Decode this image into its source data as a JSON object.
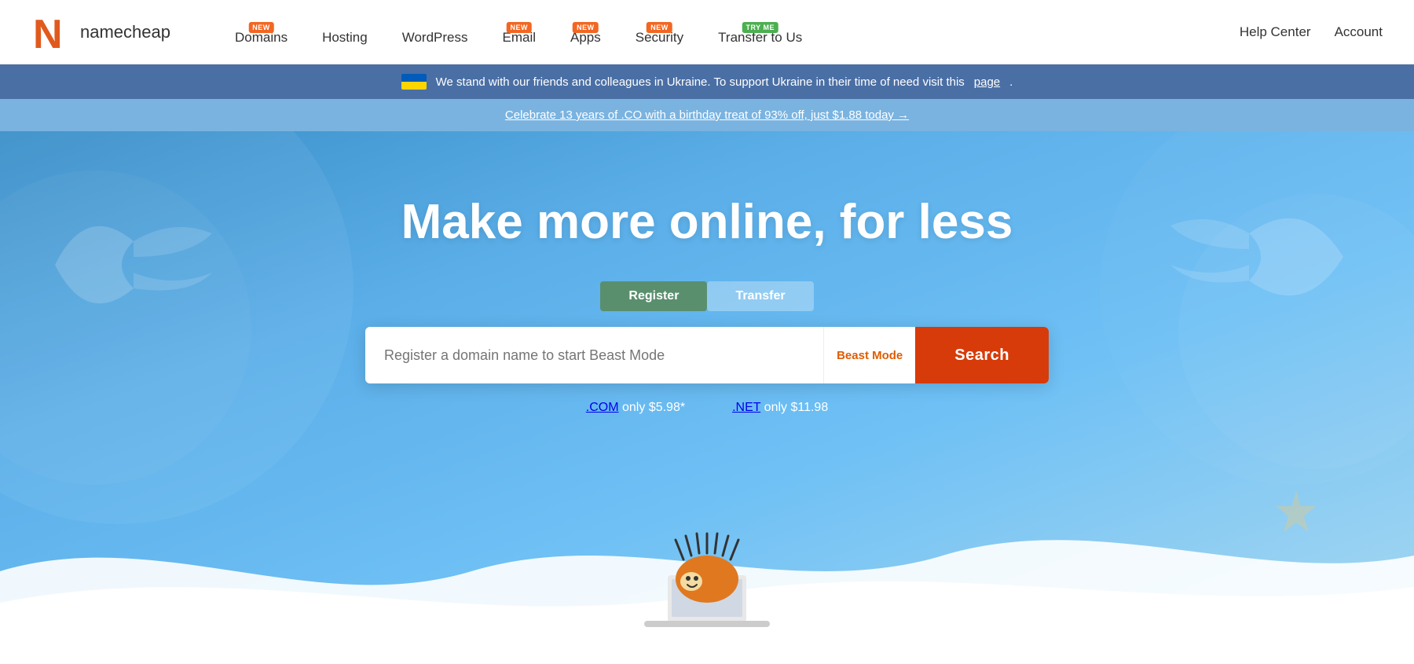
{
  "header": {
    "logo_text": "namecheap",
    "nav_items": [
      {
        "label": "Domains",
        "badge": "NEW",
        "badge_type": "new"
      },
      {
        "label": "Hosting",
        "badge": null
      },
      {
        "label": "WordPress",
        "badge": null
      },
      {
        "label": "Email",
        "badge": "NEW",
        "badge_type": "new"
      },
      {
        "label": "Apps",
        "badge": "NEW",
        "badge_type": "new"
      },
      {
        "label": "Security",
        "badge": "NEW",
        "badge_type": "new"
      },
      {
        "label": "Transfer to Us",
        "badge": "TRY ME",
        "badge_type": "tryme"
      }
    ],
    "right_items": [
      {
        "label": "Help Center"
      },
      {
        "label": "Account"
      }
    ]
  },
  "ukraine_banner": {
    "text": "We stand with our friends and colleagues in Ukraine. To support Ukraine in their time of need visit this ",
    "link_text": "page",
    "link_url": "#"
  },
  "promo_banner": {
    "text": "Celebrate 13 years of .CO with a birthday treat of 93% off, just $1.88 today →",
    "link_url": "#"
  },
  "hero": {
    "title": "Make more online, for less",
    "tab_register": "Register",
    "tab_transfer": "Transfer",
    "search_placeholder": "Register a domain name to start Beast Mode",
    "beast_mode_label": "Beast Mode",
    "search_button_label": "Search",
    "price_com": ".COM only $5.98*",
    "price_net": ".NET only $11.98",
    "com_label": ".COM",
    "net_label": ".NET"
  }
}
